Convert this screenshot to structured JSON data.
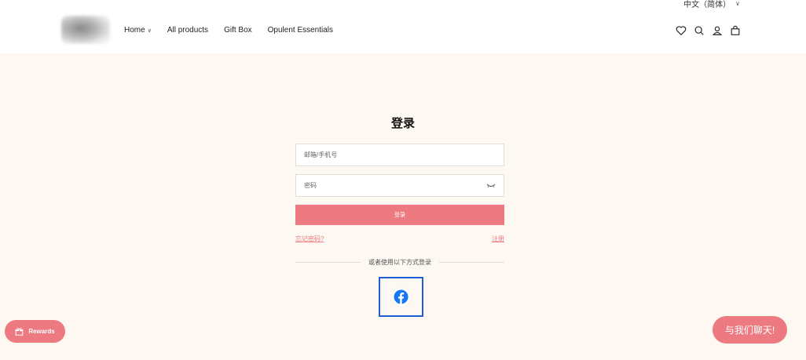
{
  "header": {
    "language": "中文（简体）",
    "nav": [
      {
        "label": "Home",
        "has_dropdown": true
      },
      {
        "label": "All products"
      },
      {
        "label": "Gift Box"
      },
      {
        "label": "Opulent Essentials"
      }
    ],
    "icons": [
      "heart-icon",
      "search-icon",
      "account-icon",
      "bag-icon"
    ]
  },
  "login": {
    "title": "登录",
    "email_placeholder": "邮箱/手机号",
    "password_placeholder": "密码",
    "submit_label": "登录",
    "forgot_label": "忘记密码?",
    "register_label": "注册",
    "divider_text": "或者使用以下方式登录",
    "social": [
      "facebook-icon"
    ]
  },
  "floating": {
    "rewards_label": "Rewards",
    "chat_label": "与我们聊天!"
  },
  "colors": {
    "accent": "#ec7a80",
    "background": "#fdf8f2",
    "facebook": "#1877f2",
    "focus_outline": "#1f5fd6"
  }
}
